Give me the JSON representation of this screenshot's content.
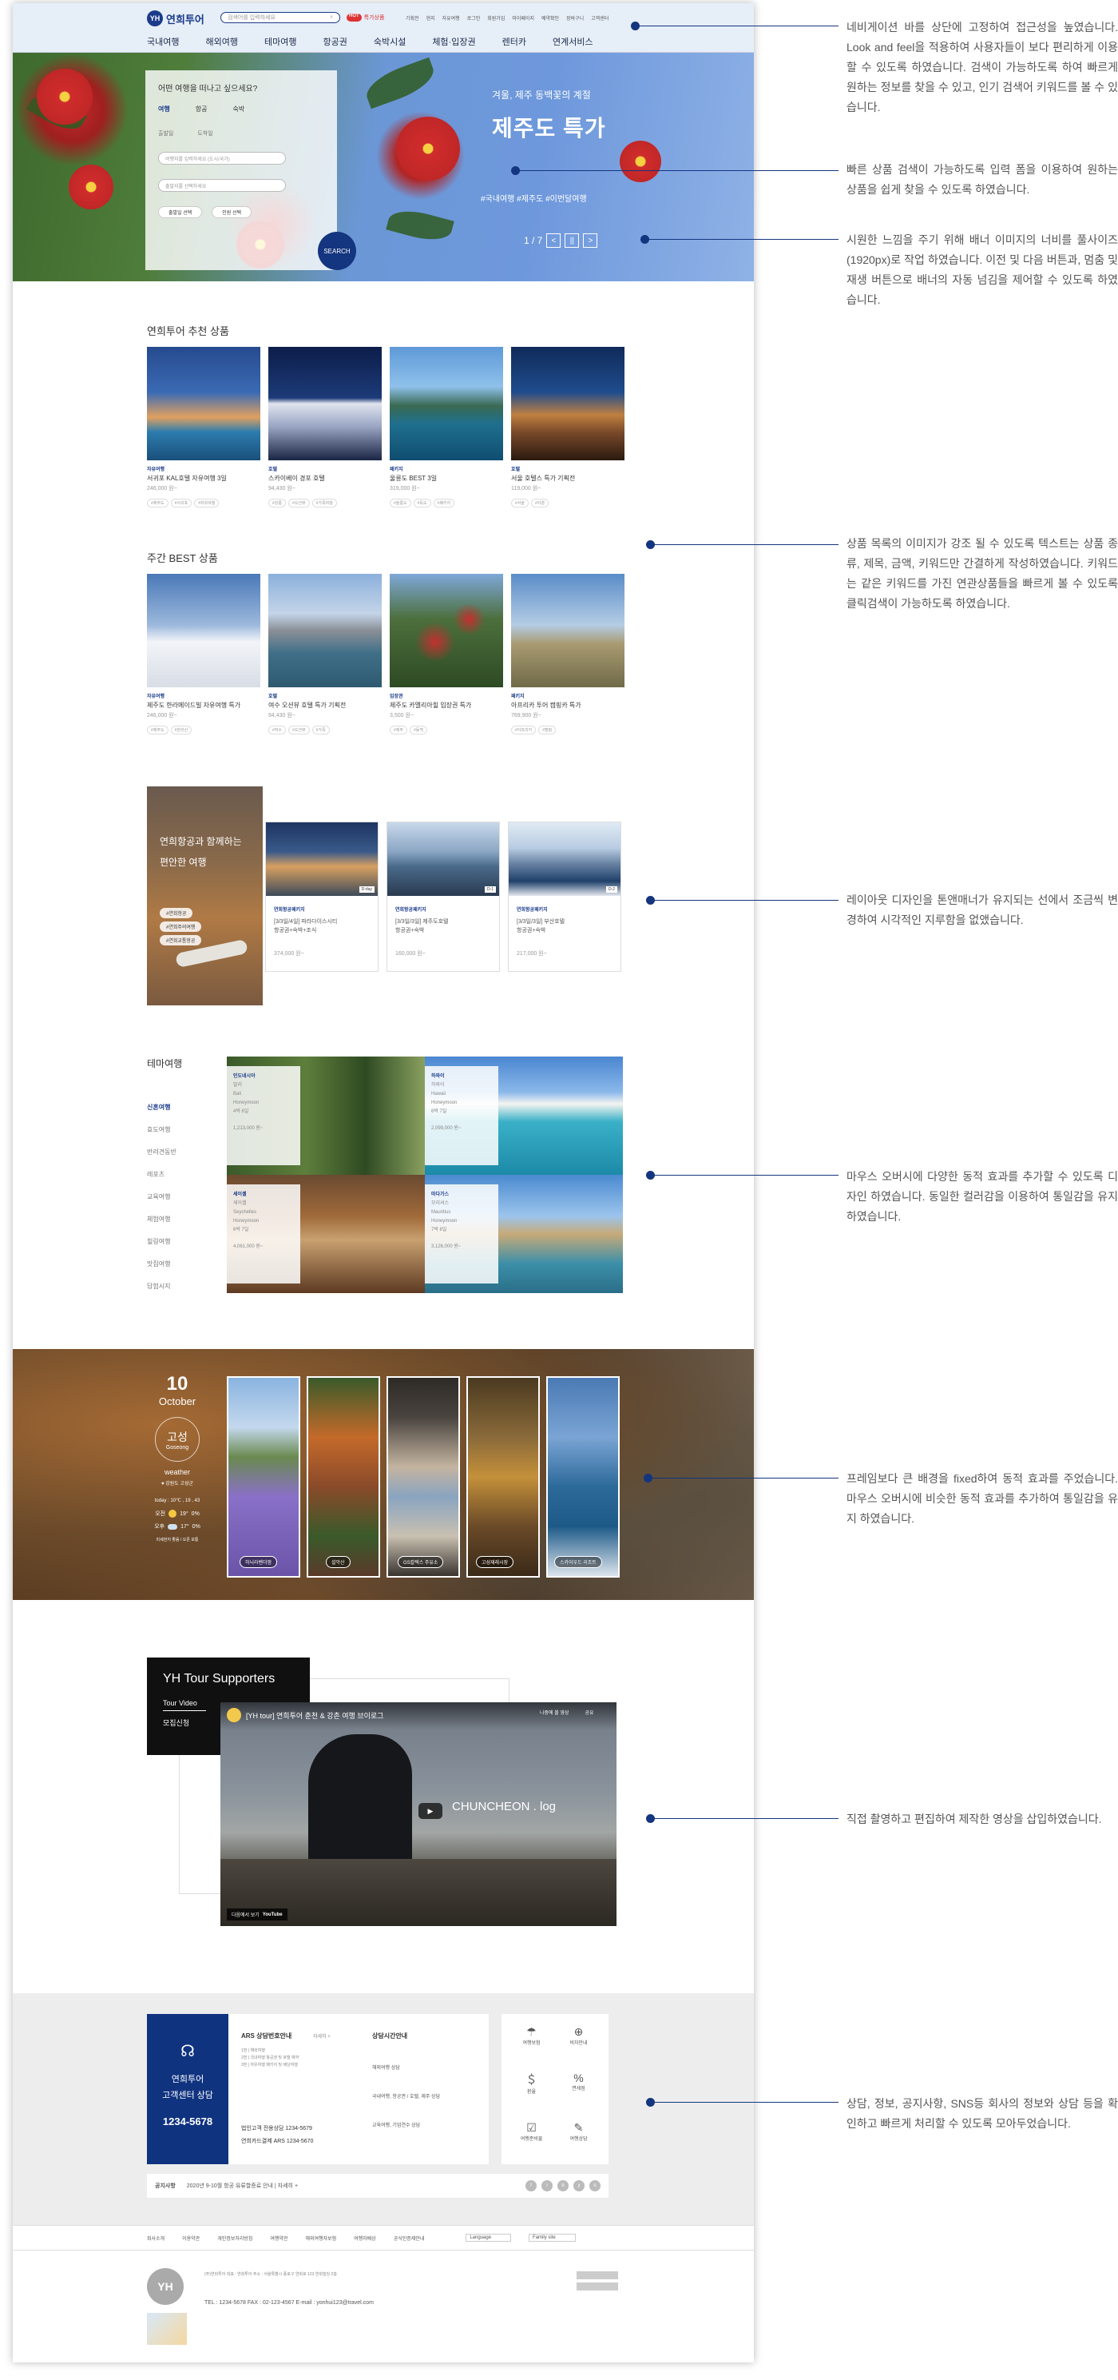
{
  "header": {
    "logo_badge": "YH",
    "logo_text": "연희투어",
    "search_placeholder": "검색어를 입력하세요",
    "hot_badge": "HOT",
    "hot_text": "특가상품",
    "util": [
      "기획전",
      "현지",
      "자유여행",
      "로그인",
      "회원가입",
      "마이페이지",
      "예약확인",
      "장바구니",
      "고객센터"
    ],
    "gnb": [
      "국내여행",
      "해외여행",
      "테마여행",
      "항공권",
      "숙박시설",
      "체험·입장권",
      "렌터카",
      "연계서비스"
    ]
  },
  "hero": {
    "search_title": "어떤 여행을 떠나고 싶으세요?",
    "tabs": [
      "여행",
      "항공",
      "숙박"
    ],
    "row_labels": [
      "출발일",
      "도착일"
    ],
    "field_1": "여행지를 입력하세요 (도시/국가)",
    "field_2": "출발지를 선택하세요",
    "btn_1": "출발일 선택",
    "btn_2": "인원 선택",
    "search_btn": "SEARCH",
    "sub": "겨울, 제주 동백꽃의 계절",
    "title": "제주도 특가",
    "tags": "#국내여행   #제주도   #이번달여행",
    "counter": "1 / 7",
    "prev_label": "<",
    "pause_label": "||",
    "next_label": ">"
  },
  "recommend": {
    "title": "연희투어 추천 상품",
    "items": [
      {
        "cat": "자유여행",
        "name": "서귀포 KAL호텔 자유여행 3일",
        "price": "246,000 원~",
        "kw": [
          "#제주도",
          "#서귀포",
          "#자유여행"
        ]
      },
      {
        "cat": "호텔",
        "name": "스카이베이 경포 호텔",
        "price": "94,430 원~",
        "kw": [
          "#강릉",
          "#오션뷰",
          "#가족여행"
        ]
      },
      {
        "cat": "패키지",
        "name": "울릉도 BEST 3일",
        "price": "319,000 원~",
        "kw": [
          "#울릉도",
          "#독도",
          "#패키지"
        ]
      },
      {
        "cat": "호텔",
        "name": "서울 호텔스 특가 기획전",
        "price": "119,000 원~",
        "kw": [
          "#서울",
          "#야경"
        ]
      }
    ]
  },
  "best": {
    "title": "주간 BEST 상품",
    "items": [
      {
        "cat": "자유여행",
        "name": "제주도 한라메이드빌 자유여행 특가",
        "price": "246,000 원~",
        "kw": [
          "#제주도",
          "#한라산"
        ]
      },
      {
        "cat": "호텔",
        "name": "여수 오션뷰 호텔 특가 기획전",
        "price": "94,430 원~",
        "kw": [
          "#여수",
          "#오션뷰",
          "#가족"
        ]
      },
      {
        "cat": "입장권",
        "name": "제주도 카멜리아힐 입장권 특가",
        "price": "3,500 원~",
        "kw": [
          "#제주",
          "#동백"
        ]
      },
      {
        "cat": "패키지",
        "name": "아프리카 투어 캠핑카 특가",
        "price": "769,900 원~",
        "kw": [
          "#아프리카",
          "#캠핑"
        ]
      }
    ]
  },
  "airline": {
    "title_l1": "연희항공과 함께하는",
    "title_l2": "편안한 여행",
    "pills": [
      "#연희항공",
      "#연희주의여행",
      "#연희교통항공"
    ],
    "items": [
      {
        "cat": "연희항공패키지",
        "name1": "[3/3일/4일] 파라다이스시티",
        "name2": "항공권+숙박+조식",
        "price": "374,000 원~",
        "badge": "D-day"
      },
      {
        "cat": "연희항공패키지",
        "name1": "[3/3일/3일] 제주도호텔",
        "name2": "항공권+숙박",
        "price": "160,000 원~",
        "badge": "D-1"
      },
      {
        "cat": "연희항공패키지",
        "name1": "[3/3일/3일] 부산호텔",
        "name2": "항공권+숙박",
        "price": "217,000 원~",
        "badge": "D-2"
      }
    ]
  },
  "theme": {
    "title": "테마여행",
    "menu": [
      "신혼여행",
      "효도여행",
      "반려견동반",
      "레포츠",
      "교육여행",
      "체험여행",
      "힐링여행",
      "맛집여행",
      "답험시지"
    ],
    "cards": [
      {
        "cat": "인도네시아",
        "l1": "발리",
        "l2": "Bali",
        "l3": "Honeymoon",
        "l4": "4박 6일",
        "price": "1,213,000 원~"
      },
      {
        "cat": "하와이",
        "l1": "하와이",
        "l2": "Hawaii",
        "l3": "Honeymoon",
        "l4": "6박 7일",
        "price": "2,099,000 원~"
      },
      {
        "cat": "세이셸",
        "l1": "세이셸",
        "l2": "Seychelles",
        "l3": "Honeymoon",
        "l4": "6박 7일",
        "price": "4,061,000 원~"
      },
      {
        "cat": "마다가스",
        "l1": "모리셔스",
        "l2": "Mauritius",
        "l3": "Honeymoon",
        "l4": "7박 8일",
        "price": "3,126,000 원~"
      }
    ]
  },
  "weather": {
    "day": "10",
    "month": "October",
    "place_kr": "고성",
    "place_en": "Goseong",
    "label": "weather",
    "region": "♥ 강원도 고성군",
    "today": "today : 10℃ , 19 , 43",
    "t1": "오전",
    "t1v": "19°",
    "t1s": "0%",
    "t2": "오후",
    "t2v": "17°",
    "t2s": "0%",
    "extra": "미세먼지 좋음 / 오존 보통",
    "spots": [
      "하늬라벤더팜",
      "설악산",
      "GS칼텍스 주유소",
      "고성재래시장",
      "스카이우드 리조트"
    ]
  },
  "supporters": {
    "title": "YH Tour Supporters",
    "menu_1": "Tour Video",
    "menu_2": "모집신청",
    "video_title": "[YH tour] 연희투어 춘천 & 강촌 여행 브이로그",
    "video_text": "CHUNCHEON . log",
    "watch_on": "다음에서 보기",
    "yt": "YouTube",
    "later": "나중에 볼 영상",
    "share": "공유"
  },
  "cs": {
    "title_1": "연희투어",
    "title_2": "고객센터 상담",
    "phone": "1234-5678",
    "ars": "ARS 상담번호안내",
    "ars_more": "자세히 +",
    "ars_lines": [
      "1번 | 해외여행",
      "2번 | 국내여행 항공권 및 호텔 예약",
      "3번 | 자유여행 패키지 및 배낭여행"
    ],
    "hours": "상담시간안내",
    "hour_lines": [
      "해외여행 상담",
      "국내여행, 항공권 / 호텔, 제주 상담",
      "교육여행, 기업연수 상담"
    ],
    "phone_lines": [
      "법인고객 전용상담   1234-5679",
      "연희카드결제 ARS   1234-5670"
    ],
    "icons": [
      "여행보험",
      "비자안내",
      "환율",
      "면세점",
      "여행준비물",
      "여행상담"
    ],
    "notice_label": "공지사항",
    "notice_text": "2020년 9-10월 항공 유류할증료 안내  |  자세히 +",
    "socials": [
      "f",
      "i",
      "b",
      "y",
      "n"
    ]
  },
  "footer": {
    "nav": [
      "회사소개",
      "이용약관",
      "개인정보처리방침",
      "여행약관",
      "해외여행자보험",
      "여행자배상",
      "공식인증제안내"
    ],
    "lang": "Language",
    "family": "Family site",
    "tel": "TEL : 1234-5678     FAX : 02-123-4567     E-mail : yonhui123@travel.com",
    "biz": "(주)연희투어   대표 : 연희투어   주소 : 서울특별시 종로구 연희로 123 연희빌딩 2층",
    "logo": "YH"
  },
  "notes": [
    "네비게이션 바를 상단에 고정하여 접근성을 높였습니다. Look and feel을 적용하여 사용자들이 보다 편리하게 이용할 수 있도록 하였습니다. 검색이 가능하도록 하여 빠르게 원하는 정보를 찾을 수 있고, 인기 검색어 키워드를 볼 수 있습니다.",
    "빠른 상품 검색이 가능하도록 입력 폼을 이용하여 원하는 상품을 쉽게 찾을 수 있도록 하였습니다.",
    "시원한 느낌을 주기 위해 배너 이미지의 너비를 풀사이즈(1920px)로 작업 하였습니다. 이전 및 다음 버튼과, 멈춤 및 재생 버튼으로 배너의 자동 넘김을 제어할 수 있도록 하였습니다.",
    "상품 목록의 이미지가 강조 될 수 있도록 텍스트는 상품 종류, 제목, 금액, 키워드만 간결하게 작성하였습니다. 키워드는 같은 키워드를 가진 연관상품들을 빠르게 볼 수 있도록 클릭검색이 가능하도록 하였습니다.",
    "레이아웃 디자인을 톤앤매너가 유지되는 선에서 조금씩 변경하여 시각적인 지루함을 없앴습니다.",
    "마우스 오버시에 다양한 동적 효과를 추가할 수 있도록 디자인 하였습니다. 동일한 컬러감을 이용하여 통일감을 유지 하였습니다.",
    "프레임보다 큰 배경을 fixed하여 동적 효과를 주었습니다. 마우스 오버시에 비슷한 동적 효과를 추가하여 통일감을 유지 하였습니다.",
    "직접 촬영하고 편집하여 제작한 영상을 삽입하였습니다.",
    "상담, 정보, 공지사항, SNS등 회사의 정보와 상담 등을 확인하고 빠르게 처리할 수 있도록 모아두었습니다."
  ]
}
